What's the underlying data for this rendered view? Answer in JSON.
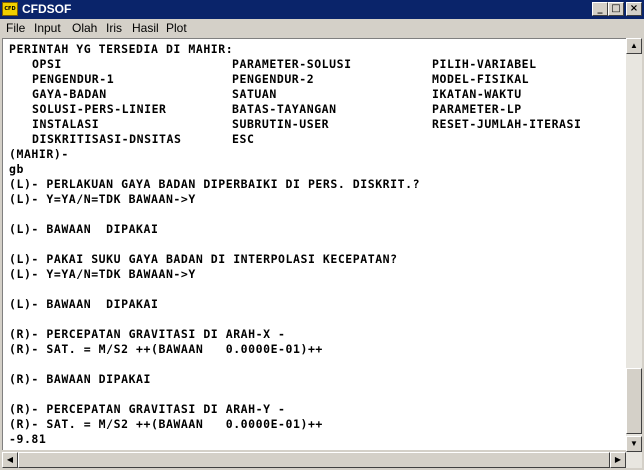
{
  "window": {
    "title": "CFDSOF",
    "icon_text": "CFD"
  },
  "menu": [
    "File",
    "Input",
    "Olah",
    "Iris",
    "Hasil",
    "Plot"
  ],
  "console": {
    "header": "PERINTAH YG TERSEDIA DI MAHIR:",
    "commands": [
      [
        "OPSI",
        "PARAMETER-SOLUSI",
        "PILIH-VARIABEL"
      ],
      [
        "PENGENDUR-1",
        "PENGENDUR-2",
        "MODEL-FISIKAL"
      ],
      [
        "GAYA-BADAN",
        "SATUAN",
        "IKATAN-WAKTU"
      ],
      [
        "SOLUSI-PERS-LINIER",
        "BATAS-TAYANGAN",
        "PARAMETER-LP"
      ],
      [
        "INSTALASI",
        "SUBRUTIN-USER",
        "RESET-JUMLAH-ITERASI"
      ],
      [
        "DISKRITISASI-DNSITAS",
        "ESC",
        ""
      ]
    ],
    "lines": [
      "(MAHIR)-",
      "gb",
      "(L)- PERLAKUAN GAYA BADAN DIPERBAIKI DI PERS. DISKRIT.?",
      "(L)- Y=YA/N=TDK BAWAAN->Y",
      "",
      "(L)- BAWAAN  DIPAKAI",
      "",
      "(L)- PAKAI SUKU GAYA BADAN DI INTERPOLASI KECEPATAN?",
      "(L)- Y=YA/N=TDK BAWAAN->Y",
      "",
      "(L)- BAWAAN  DIPAKAI",
      "",
      "(R)- PERCEPATAN GRAVITASI DI ARAH-X -",
      "(R)- SAT. = M/S2 ++(BAWAAN   0.0000E-01)++",
      "",
      "(R)- BAWAAN DIPAKAI",
      "",
      "(R)- PERCEPATAN GRAVITASI DI ARAH-Y -",
      "(R)- SAT. = M/S2 ++(BAWAAN   0.0000E-01)++",
      "-9.81"
    ]
  }
}
